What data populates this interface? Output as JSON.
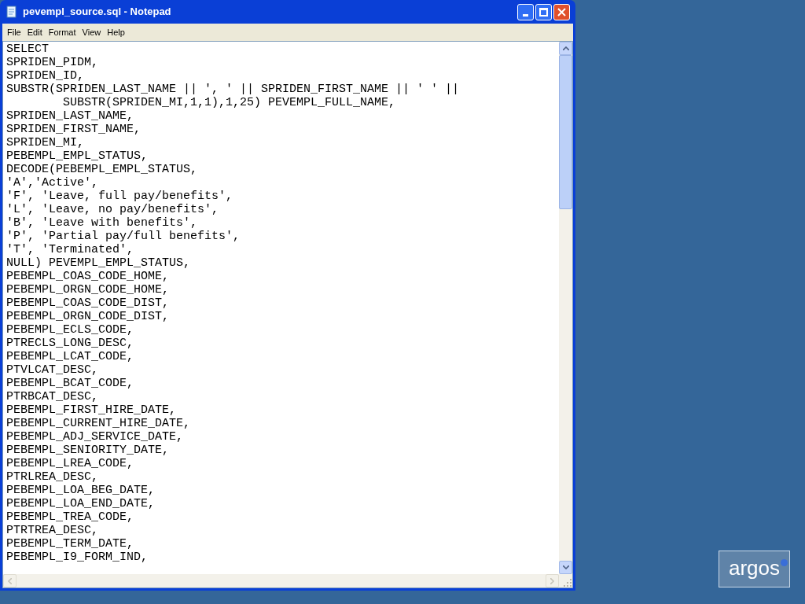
{
  "window": {
    "title": "pevempl_source.sql - Notepad"
  },
  "menu": [
    "File",
    "Edit",
    "Format",
    "View",
    "Help"
  ],
  "editor": {
    "lines": [
      "SELECT",
      "SPRIDEN_PIDM,",
      "SPRIDEN_ID,",
      "SUBSTR(SPRIDEN_LAST_NAME || ', ' || SPRIDEN_FIRST_NAME || ' ' ||",
      "        SUBSTR(SPRIDEN_MI,1,1),1,25) PEVEMPL_FULL_NAME,",
      "SPRIDEN_LAST_NAME,",
      "SPRIDEN_FIRST_NAME,",
      "SPRIDEN_MI,",
      "PEBEMPL_EMPL_STATUS,",
      "DECODE(PEBEMPL_EMPL_STATUS,",
      "'A','Active',",
      "'F', 'Leave, full pay/benefits',",
      "'L', 'Leave, no pay/benefits',",
      "'B', 'Leave with benefits',",
      "'P', 'Partial pay/full benefits',",
      "'T', 'Terminated',",
      "NULL) PEVEMPL_EMPL_STATUS,",
      "PEBEMPL_COAS_CODE_HOME,",
      "PEBEMPL_ORGN_CODE_HOME,",
      "PEBEMPL_COAS_CODE_DIST,",
      "PEBEMPL_ORGN_CODE_DIST,",
      "PEBEMPL_ECLS_CODE,",
      "PTRECLS_LONG_DESC,",
      "PEBEMPL_LCAT_CODE,",
      "PTVLCAT_DESC,",
      "PEBEMPL_BCAT_CODE,",
      "PTRBCAT_DESC,",
      "PEBEMPL_FIRST_HIRE_DATE,",
      "PEBEMPL_CURRENT_HIRE_DATE,",
      "PEBEMPL_ADJ_SERVICE_DATE,",
      "PEBEMPL_SENIORITY_DATE,",
      "PEBEMPL_LREA_CODE,",
      "PTRLREA_DESC,",
      "PEBEMPL_LOA_BEG_DATE,",
      "PEBEMPL_LOA_END_DATE,",
      "PEBEMPL_TREA_CODE,",
      "PTRTREA_DESC,",
      "PEBEMPL_TERM_DATE,",
      "PEBEMPL_I9_FORM_IND,"
    ]
  },
  "logo": {
    "text": "argos"
  }
}
